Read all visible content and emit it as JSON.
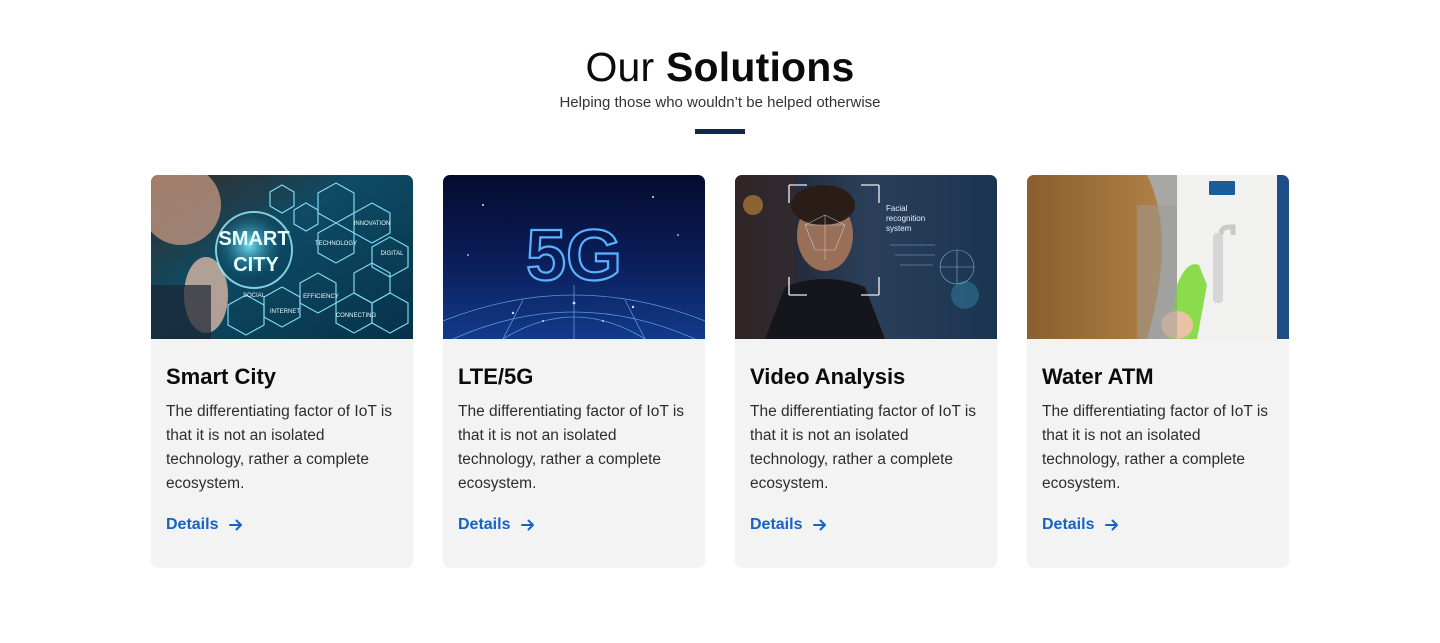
{
  "header": {
    "title_part1": "Our",
    "title_part2": "Solutions",
    "subtitle": "Helping those who wouldn’t be helped otherwise"
  },
  "cards": [
    {
      "title": "Smart City",
      "description": "The differentiating factor of IoT is that it is not an isolated technology, rather a complete ecosystem.",
      "link_label": "Details",
      "image_text": [
        "SMART",
        "CITY",
        "INNOVATION",
        "TECHNOLOGY",
        "DIGITAL",
        "SOCIAL",
        "EFFICIENCY",
        "INTERNET",
        "CONNECTING"
      ]
    },
    {
      "title": "LTE/5G",
      "description": "The differentiating factor of IoT is that it is not an isolated technology, rather a complete ecosystem.",
      "link_label": "Details",
      "image_text": [
        "5G"
      ]
    },
    {
      "title": "Video Analysis",
      "description": "The differentiating factor of IoT is that it is not an isolated technology, rather a complete ecosystem.",
      "link_label": "Details",
      "image_text": [
        "Facial",
        "recognition",
        "system"
      ]
    },
    {
      "title": "Water ATM",
      "description": "The differentiating factor of IoT is that it is not an isolated technology, rather a complete ecosystem.",
      "link_label": "Details",
      "image_text": []
    }
  ],
  "colors": {
    "accent_link": "#1464c8",
    "divider": "#13294b",
    "card_bg": "#f3f3f3"
  },
  "icons": {
    "details_arrow": "arrow-right-icon"
  }
}
